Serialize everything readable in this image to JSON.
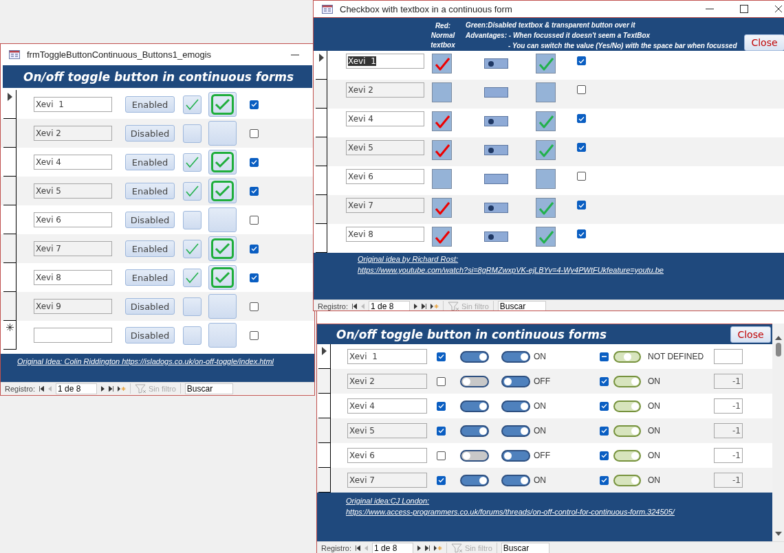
{
  "windows": [
    {
      "kind": "emoji-buttons",
      "title": "frmToggleButtonContinuous_Buttons1_emogis",
      "heading": "On/off toggle button in continuous forms",
      "rows": [
        {
          "kind": "record",
          "name": "Xevi  1",
          "status": "Enabled",
          "on": true,
          "current": true
        },
        {
          "kind": "record",
          "name": "Xevi 2",
          "status": "Disabled",
          "on": false,
          "current": false
        },
        {
          "kind": "record",
          "name": "Xevi 4",
          "status": "Enabled",
          "on": true,
          "current": false
        },
        {
          "kind": "record",
          "name": "Xevi 5",
          "status": "Enabled",
          "on": true,
          "current": false
        },
        {
          "kind": "record",
          "name": "Xevi 6",
          "status": "Disabled",
          "on": false,
          "current": false
        },
        {
          "kind": "record",
          "name": "Xevi 7",
          "status": "Enabled",
          "on": true,
          "current": false
        },
        {
          "kind": "record",
          "name": "Xevi 8",
          "status": "Enabled",
          "on": true,
          "current": false
        },
        {
          "kind": "record",
          "name": "Xevi 9",
          "status": "Disabled",
          "on": false,
          "current": false
        },
        {
          "kind": "new",
          "status": "Disabled",
          "on": false,
          "current": false
        }
      ],
      "footer": [
        "Original Idea: Colin Riddington https://isladogs.co.uk/on-off-toggle/index.html"
      ],
      "status_bar": {
        "label": "Registro:",
        "position": "1 de 8",
        "filter": "Sin filtro",
        "search": "Buscar"
      }
    },
    {
      "kind": "checkbox-textbox",
      "title": "Checkbox with textbox in a continuous form",
      "column_label": "Red: Normal textbox",
      "notes": [
        "Green:Disabled textbox & transparent button over it",
        "Advantages: - When focussed it doesn't seem a TextBox",
        "- You can switch the value (Yes/No) with the space bar when focussed"
      ],
      "close": "Close",
      "rows": [
        {
          "kind": "record",
          "name": "Xevi  1",
          "on": true,
          "current": true
        },
        {
          "kind": "record",
          "name": "Xevi 2",
          "on": false,
          "current": false
        },
        {
          "kind": "record",
          "name": "Xevi 4",
          "on": true,
          "current": false
        },
        {
          "kind": "record",
          "name": "Xevi 5",
          "on": true,
          "current": false
        },
        {
          "kind": "record",
          "name": "Xevi 6",
          "on": false,
          "current": false
        },
        {
          "kind": "record",
          "name": "Xevi 7",
          "on": true,
          "current": false
        },
        {
          "kind": "record",
          "name": "Xevi 8",
          "on": true,
          "current": false
        }
      ],
      "footer": [
        "Original idea by Richard Rost:",
        "https://www.youtube.com/watch?si=8gRMZwxpVK-ejLBYv=4-Wy4PWtFUkfeature=youtu.be"
      ],
      "status_bar": {
        "label": "Registro:",
        "position": "1 de 8",
        "filter": "Sin filtro",
        "search": "Buscar"
      }
    },
    {
      "kind": "toggle-images",
      "heading": "On/off toggle button in continuous forms",
      "close": "Close",
      "rows": [
        {
          "kind": "record",
          "name": "Xevi  1",
          "checked": true,
          "toggle_label": "ON",
          "indeterminate": true,
          "tri_checked": true,
          "tri_label": "NOT DEFINED",
          "current": true
        },
        {
          "kind": "record",
          "name": "Xevi 2",
          "checked": false,
          "toggle_label": "OFF",
          "indeterminate": false,
          "tri_checked": true,
          "tri_label": "ON",
          "value": "-1",
          "current": false
        },
        {
          "kind": "record",
          "name": "Xevi 4",
          "checked": true,
          "toggle_label": "ON",
          "indeterminate": false,
          "tri_checked": true,
          "tri_label": "ON",
          "value": "-1",
          "current": false
        },
        {
          "kind": "record",
          "name": "Xevi 5",
          "checked": true,
          "toggle_label": "ON",
          "indeterminate": false,
          "tri_checked": true,
          "tri_label": "ON",
          "value": "-1",
          "current": false
        },
        {
          "kind": "record",
          "name": "Xevi 6",
          "checked": false,
          "toggle_label": "OFF",
          "indeterminate": false,
          "tri_checked": true,
          "tri_label": "ON",
          "value": "-1",
          "current": false
        },
        {
          "kind": "record",
          "name": "Xevi 7",
          "checked": true,
          "toggle_label": "ON",
          "indeterminate": false,
          "tri_checked": true,
          "tri_label": "ON",
          "value": "-1",
          "current": false
        }
      ],
      "footer": [
        "Original idea:CJ  London:",
        "https://www.access-programmers.co.uk/forums/threads/on-off-control-for-continuous-form.324505/"
      ],
      "status_bar": {
        "label": "Registro:",
        "position": "1 de 8",
        "filter": "Sin filtro",
        "search": "Buscar"
      }
    }
  ]
}
